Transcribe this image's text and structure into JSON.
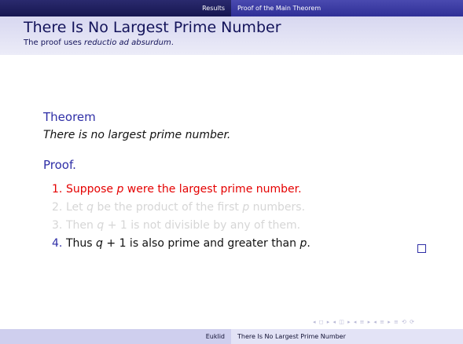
{
  "header_nav": {
    "section_left": "Results",
    "section_right": "Proof of the Main Theorem"
  },
  "frame": {
    "title": "There Is No Largest Prime Number",
    "subtitle_prefix": "The proof uses ",
    "subtitle_emph": "reductio ad absurdum",
    "subtitle_suffix": "."
  },
  "theorem": {
    "heading": "Theorem",
    "statement": "There is no largest prime number."
  },
  "proof": {
    "heading": "Proof.",
    "items": [
      {
        "num": "1.",
        "state": "active",
        "parts": [
          "Suppose ",
          "p",
          " were the largest prime number."
        ]
      },
      {
        "num": "2.",
        "state": "faded",
        "parts": [
          "Let ",
          "q",
          " be the product of the first ",
          "p",
          " numbers."
        ]
      },
      {
        "num": "3.",
        "state": "faded",
        "parts": [
          "Then ",
          "q",
          " + 1 is not divisible by any of them."
        ]
      },
      {
        "num": "4.",
        "state": "normal",
        "parts": [
          "Thus ",
          "q",
          " + 1 is also prime and greater than ",
          "p",
          "."
        ]
      }
    ],
    "qed_symbol": "□"
  },
  "nav_symbols": "◂ ◻ ▸ ◂ ◫ ▸ ◂ ≡ ▸ ◂ ≡ ▸  ≡  ⟲ ⟳",
  "footline": {
    "author": "Euklid",
    "short_title": "There Is No Largest Prime Number"
  },
  "colors": {
    "structure": "#2e2ea6",
    "alert": "#e50000",
    "faded": "#d6d6d6",
    "header_dark": "#161650",
    "header_light": "#2f2f96"
  }
}
